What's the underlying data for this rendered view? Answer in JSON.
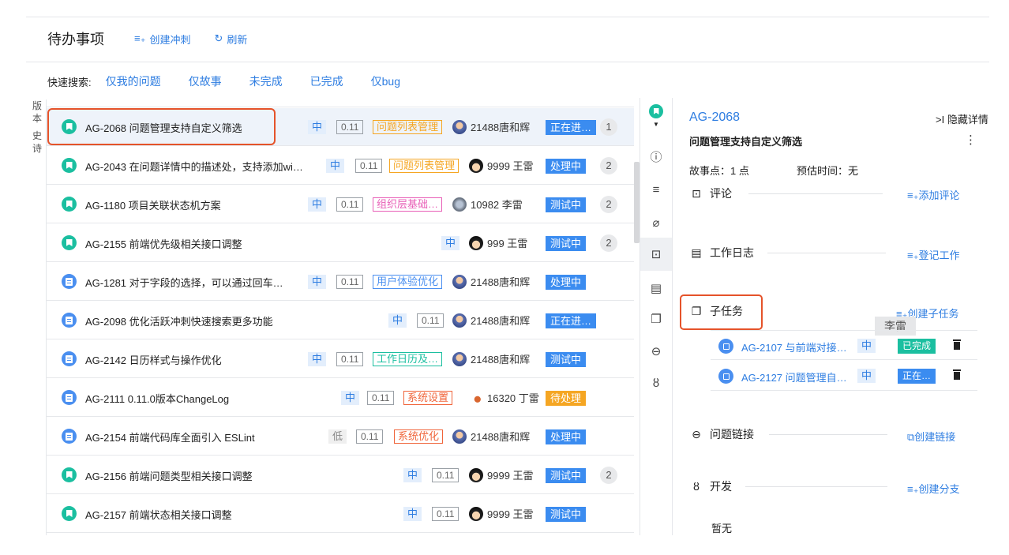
{
  "header": {
    "title": "待办事项",
    "create_sprint": "创建冲刺",
    "refresh": "刷新"
  },
  "quick_search": {
    "label": "快速搜索:",
    "items": [
      "仅我的问题",
      "仅故事",
      "未完成",
      "已完成",
      "仅bug"
    ]
  },
  "side_tabs": [
    {
      "chars": [
        "版",
        "本"
      ]
    },
    {
      "chars": [
        "史",
        "诗"
      ]
    }
  ],
  "issues": [
    {
      "key_summary": "AG-2068 问题管理支持自定义筛选",
      "type": "story",
      "priority": "中",
      "version": "0.11",
      "epic": "问题列表管理",
      "epic_color": "orange",
      "assignee": "21488唐和辉",
      "status": "正在进…",
      "status_color": "blue",
      "count": "1",
      "selected": true
    },
    {
      "key_summary": "AG-2043 在问题详情中的描述处，支持添加wi…",
      "type": "story",
      "priority": "中",
      "version": "0.11",
      "epic": "问题列表管理",
      "epic_color": "orange",
      "assignee": "9999 王雷",
      "status": "处理中",
      "status_color": "blue",
      "count": "2"
    },
    {
      "key_summary": "AG-1180 项目关联状态机方案",
      "type": "story",
      "priority": "中",
      "version": "0.11",
      "epic": "组织层基础…",
      "epic_color": "pink",
      "assignee": "10982 李雷",
      "status": "测试中",
      "status_color": "blue",
      "count": "2"
    },
    {
      "key_summary": "AG-2155 前端优先级相关接口调整",
      "type": "story",
      "priority": "中",
      "version": "",
      "epic": "",
      "assignee": "999 王雷",
      "status": "测试中",
      "status_color": "blue",
      "count": "2"
    },
    {
      "key_summary": "AG-1281 对于字段的选择，可以通过回车…",
      "type": "task",
      "priority": "中",
      "version": "0.11",
      "epic": "用户体验优化",
      "epic_color": "blue",
      "assignee": "21488唐和辉",
      "status": "处理中",
      "status_color": "blue",
      "count": ""
    },
    {
      "key_summary": "AG-2098 优化活跃冲刺快速搜索更多功能",
      "type": "task",
      "priority": "中",
      "version": "0.11",
      "epic": "",
      "assignee": "21488唐和辉",
      "status": "正在进…",
      "status_color": "blue",
      "count": ""
    },
    {
      "key_summary": "AG-2142 日历样式与操作优化",
      "type": "task",
      "priority": "中",
      "version": "0.11",
      "epic": "工作日历及…",
      "epic_color": "teal",
      "assignee": "21488唐和辉",
      "status": "测试中",
      "status_color": "blue",
      "count": ""
    },
    {
      "key_summary": "AG-2111 0.11.0版本ChangeLog",
      "type": "task",
      "priority": "中",
      "version": "0.11",
      "epic": "系统设置",
      "epic_color": "red",
      "assignee": "16320 丁雷",
      "status": "待处理",
      "status_color": "yellow",
      "count": ""
    },
    {
      "key_summary": "AG-2154 前端代码库全面引入 ESLint",
      "type": "task",
      "priority": "低",
      "version": "0.11",
      "epic": "系统优化",
      "epic_color": "red",
      "assignee": "21488唐和辉",
      "status": "处理中",
      "status_color": "blue",
      "count": ""
    },
    {
      "key_summary": "AG-2156 前端问题类型相关接口调整",
      "type": "story",
      "priority": "中",
      "version": "0.11",
      "epic": "",
      "assignee": "9999 王雷",
      "status": "测试中",
      "status_color": "blue",
      "count": "2"
    },
    {
      "key_summary": "AG-2157 前端状态相关接口调整",
      "type": "story",
      "priority": "中",
      "version": "0.11",
      "epic": "",
      "assignee": "9999 王雷",
      "status": "测试中",
      "status_color": "blue",
      "count": ""
    }
  ],
  "detail": {
    "key": "AG-2068",
    "hide_label": ">I 隐藏详情",
    "title": "问题管理支持自定义筛选",
    "more": "⋮",
    "story_points": "故事点：1 点",
    "estimate": "预估时间：无",
    "sections": {
      "comment": {
        "title": "评论",
        "action": "≡₊添加评论"
      },
      "worklog": {
        "title": "工作日志",
        "action": "≡₊登记工作"
      },
      "subtasks": {
        "title": "子任务",
        "action": "≡₊创建子任务"
      },
      "links": {
        "title": "问题链接",
        "action": "⧉创建链接"
      },
      "dev": {
        "title": "开发",
        "action": "≡₊创建分支"
      }
    },
    "tooltip": "李雷",
    "subtasks": [
      {
        "key": "AG-2107 与前端对接…",
        "priority": "中",
        "status": "已完成",
        "status_type": "done"
      },
      {
        "key": "AG-2127 问题管理自…",
        "priority": "中",
        "status": "正在…",
        "status_type": "prog"
      }
    ],
    "dev_empty": "暂无"
  },
  "colors": {
    "accent": "#2e7de1",
    "story": "#1bbfa0",
    "task": "#4a8ff0",
    "highlight": "#e5532a"
  }
}
